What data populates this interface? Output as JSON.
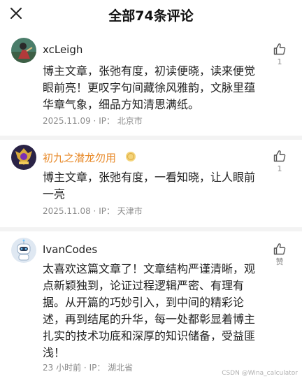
{
  "header": {
    "title": "全部74条评论",
    "close_icon": "close-icon"
  },
  "comments": [
    {
      "username": "xcLeigh",
      "text": "博主文章，张弛有度，初读便晓，读来便觉眼前亮！更叹字句间藏徐风雅韵，文脉里蕴华章气象，细品方知清思满纸。",
      "date": "2025.11.09",
      "ip_label": "IP：",
      "location": "北京市",
      "likes": "1",
      "like_icon": "thumbs-up-icon"
    },
    {
      "username": "初九之潜龙勿用",
      "username_color": "#e88a2a",
      "badge_icon": "gold-coin-icon",
      "text": "博主文章，张弛有度，一看知晓，让人眼前一亮",
      "date": "2025.11.08",
      "ip_label": "IP：",
      "location": "天津市",
      "likes": "1",
      "like_icon": "thumbs-up-icon"
    },
    {
      "username": "IvanCodes",
      "text": "太喜欢这篇文章了！文章结构严谨清晰，观点新颖独到，论证过程逻辑严密、有理有据。从开篇的巧妙引入，到中间的精彩论述，再到结尾的升华，每一处都彰显着博主扎实的技术功底和深厚的知识储备，受益匪浅！",
      "date": "23 小时前",
      "ip_label": "IP：",
      "location": "湖北省",
      "likes": "赞",
      "like_icon": "thumbs-up-icon"
    }
  ],
  "watermark": "CSDN @Wina_calculator"
}
